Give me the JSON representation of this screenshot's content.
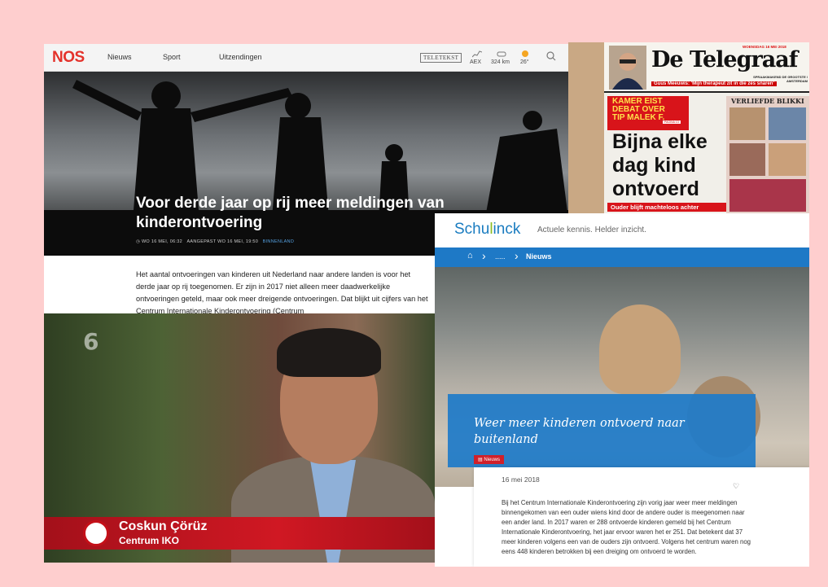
{
  "nos": {
    "logo": "NOS",
    "nav": [
      "Nieuws",
      "Sport",
      "Uitzendingen"
    ],
    "teletekst": "TELETEKST",
    "aex": "AEX",
    "traffic": "324 km",
    "weather": "26°",
    "headline": "Voor derde jaar op rij meer meldingen van kinderontvoering",
    "meta_time": "WO 16 MEI, 06:32",
    "meta_updated": "AANGEPAST WO 16 MEI, 19:50",
    "meta_category": "BINNENLAND",
    "body": "Het aantal ontvoeringen van kinderen uit Nederland naar andere landen is voor het derde jaar op rij toegenomen. Er zijn in 2017 niet alleen meer daadwerkelijke ontvoeringen geteld, maar ook meer dreigende ontvoeringen. Dat blijkt uit cijfers van het Centrum Internationale Kinderontvoering (Centrum"
  },
  "telegraaf": {
    "masthead": "De Telegraaf",
    "date": "WOENSDAG 16 MEI 2018",
    "edition": "SPRAAKMAKEND DE GROOTSTE / AMSTERDAM",
    "caption": "Guus Meeuwis: 'Mijn therapeut zit in die zes snaren'",
    "kicker": "KAMER EIST DEBAT OVER TIP MALEK F.",
    "kicker_ref": "PAGINA 13",
    "side_head": "VERLIEFDE BLIKKI",
    "headline": "Bijna elke dag kind ontvoerd",
    "subline": "Ouder blijft machteloos achter"
  },
  "rtl": {
    "channel": "6",
    "name": "Coskun Çörüz",
    "role": "Centrum IKO"
  },
  "schulinck": {
    "logo_a": "Schu",
    "logo_b": "l",
    "logo_c": "inck",
    "tagline": "Actuele kennis. Helder inzicht.",
    "crumb_home": "⌂",
    "crumb_ellipsis": ".....",
    "crumb_current": "Nieuws",
    "title": "Weer meer kinderen ontvoerd naar buitenland",
    "badge": "Nieuws",
    "date": "16 mei 2018",
    "body": "Bij het Centrum Internationale Kinderontvoering zijn vorig jaar weer meer meldingen binnengekomen van een ouder wiens kind door de andere ouder is meegenomen naar een ander land. In 2017 waren er 288 ontvoerde kinderen gemeld bij het Centrum Internationale Kinderontvoering, het jaar ervoor waren het er 251. Dat betekent dat 37 meer kinderen volgens een van de ouders zijn ontvoerd. Volgens het centrum waren nog eens 448 kinderen betrokken bij een dreiging om ontvoerd te worden."
  }
}
